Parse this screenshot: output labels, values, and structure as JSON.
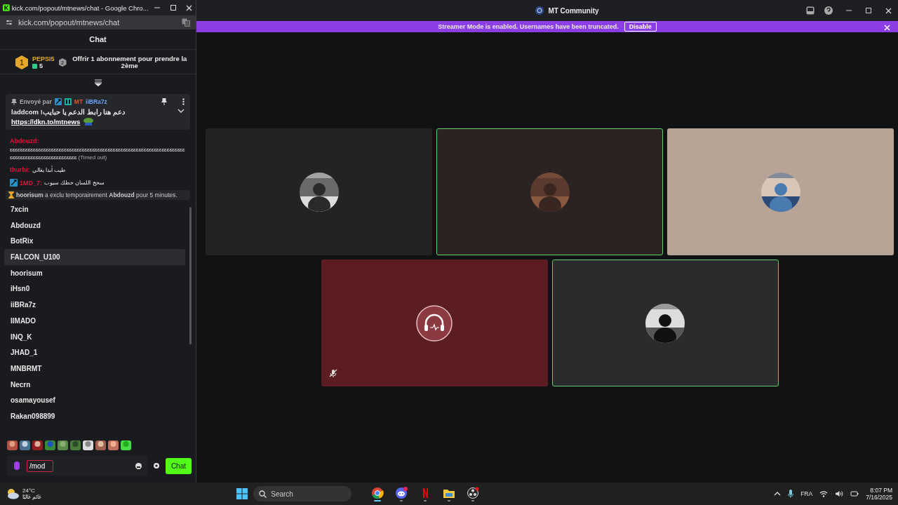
{
  "browser": {
    "title": "kick.com/popout/mtnews/chat - Google Chro...",
    "url": "kick.com/popout/mtnews/chat"
  },
  "chat": {
    "title": "Chat",
    "leaderboard": {
      "rank": "1",
      "name": "PEPSI5",
      "count": "5",
      "next_rank": "2",
      "offer": "Offrir 1 abonnement pour prendre la 2ème"
    },
    "pinned": {
      "sent_by": "Envoyé par",
      "badge": "MT",
      "user": "iiBRa7z",
      "text": "laddcom !دعم هنا رابط الدعم يا حبايب",
      "link": "https://dkn.to/mtnews"
    },
    "messages": [
      {
        "user": "Abdouzd:",
        "text": "ɛɛɛɛɛɛɛɛɛɛɛɛɛɛɛɛɛɛɛɛɛɛɛɛɛɛɛɛɛɛɛɛɛɛɛɛɛɛɛɛɛɛɛɛɛɛɛɛɛɛɛɛɛɛɛɛɛɛɛɛɛɛɛɛɛɛɛɛɛɛɛɛɛɛɛɛɛɛɛɛɛɛɛɛɛɛɛɛɛɛɛɛɛɛ",
        "status": "(Timed out)",
        "mod": false
      },
      {
        "user": "thurbi:",
        "text": "طيب أبدا يغالي",
        "mod": false
      },
      {
        "user": "1MD_7:",
        "text": "سحج اللسان حطك سيوب",
        "mod": true
      }
    ],
    "notice": "**hoorisum** a exclu temporairement **Abdouzd** pour 5 minutes.",
    "suggestions": [
      {
        "name": "7xcin",
        "selected": false
      },
      {
        "name": "Abdouzd",
        "selected": false
      },
      {
        "name": "BotRix",
        "selected": false
      },
      {
        "name": "FALCON_U100",
        "selected": true
      },
      {
        "name": "hoorisum",
        "selected": false
      },
      {
        "name": "iHsn0",
        "selected": false
      },
      {
        "name": "iiBRa7z",
        "selected": false
      },
      {
        "name": "IIMADO",
        "selected": false
      },
      {
        "name": "INQ_K",
        "selected": false
      },
      {
        "name": "JHAD_1",
        "selected": false
      },
      {
        "name": "MNBRMT",
        "selected": false
      },
      {
        "name": "Necrn",
        "selected": false
      },
      {
        "name": "osamayousef",
        "selected": false
      },
      {
        "name": "Rakan098899",
        "selected": false
      }
    ],
    "input": {
      "value": "/mod"
    },
    "send": "Chat"
  },
  "app": {
    "title": "MT Community",
    "banner": {
      "text": "Streamer Mode is enabled. Usernames have been truncated.",
      "action": "Disable"
    },
    "tiles": [
      {
        "color": "#232325",
        "speaking": false,
        "muted": false,
        "kind": "avatar"
      },
      {
        "color": "#2b2322",
        "speaking": true,
        "muted": false,
        "kind": "avatar"
      },
      {
        "color": "#b8a496",
        "speaking": false,
        "muted": false,
        "kind": "avatar"
      },
      {
        "color": "#5b1c22",
        "speaking": false,
        "muted": true,
        "kind": "headphones"
      },
      {
        "color": "#2a2b2c",
        "speaking": true,
        "muted": false,
        "kind": "avatar"
      }
    ]
  },
  "taskbar": {
    "temperature": "24°C",
    "weather": "غائم غالبًا",
    "search": "Search",
    "apps": [
      {
        "kind": "chrome",
        "active": true
      },
      {
        "kind": "discord",
        "active": false
      },
      {
        "kind": "netflix",
        "active": false
      },
      {
        "kind": "files",
        "active": false
      },
      {
        "kind": "obs",
        "active": false
      }
    ],
    "language": "FRA",
    "time": "8:07 PM",
    "date": "7/16/2025"
  }
}
